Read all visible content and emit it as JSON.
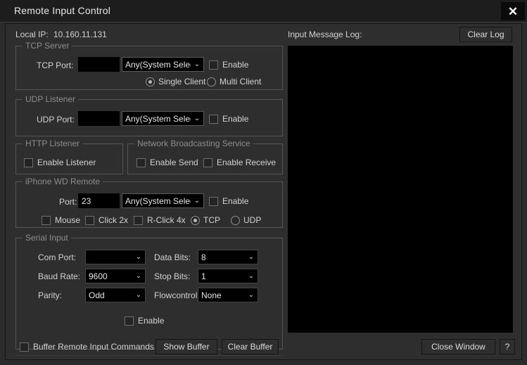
{
  "window": {
    "title": "Remote Input Control",
    "close_icon": "close-icon",
    "close_glyph": "✕"
  },
  "local_ip": {
    "label": "Local IP:",
    "value": "10.160.11.131"
  },
  "common": {
    "enable_label": "Enable",
    "chevron_glyph": "⌄",
    "any_system_selects": "Any(System Selects)"
  },
  "tcp_server": {
    "title": "TCP Server",
    "port_label": "TCP Port:",
    "port_value": "",
    "port_placeholder": "",
    "mode_combo_value": "Any(System Selects)",
    "enable_label": "Enable",
    "enable_checked": false,
    "radios": [
      {
        "label": "Single Client",
        "checked": true
      },
      {
        "label": "Multi Client",
        "checked": false
      }
    ]
  },
  "udp_listener": {
    "title": "UDP Listener",
    "port_label": "UDP Port:",
    "port_value": "",
    "mode_combo_value": "Any(System Selects)",
    "enable_label": "Enable",
    "enable_checked": false
  },
  "http_listener": {
    "title": "HTTP Listener",
    "enable_listener_label": "Enable Listener",
    "enable_listener_checked": false
  },
  "network_broadcasting": {
    "title": "Network Broadcasting Service",
    "enable_send_label": "Enable Send",
    "enable_send_checked": false,
    "enable_receive_label": "Enable Receive",
    "enable_receive_checked": false
  },
  "iphone_wd_remote": {
    "title": "iPhone WD Remote",
    "port_label": "Port:",
    "port_value": "23",
    "mode_combo_value": "Any(System Selects)",
    "enable_label": "Enable",
    "enable_checked": false,
    "mouse_label": "Mouse",
    "mouse_checked": false,
    "click2x_label": "Click 2x",
    "click2x_checked": false,
    "rclick4x_label": "R-Click 4x",
    "rclick4x_checked": false,
    "protocol_radios": [
      {
        "label": "TCP",
        "checked": true
      },
      {
        "label": "UDP",
        "checked": false
      }
    ]
  },
  "serial_input": {
    "title": "Serial Input",
    "com_port_label": "Com Port:",
    "com_port_value": "",
    "baud_rate_label": "Baud Rate:",
    "baud_rate_value": "9600",
    "parity_label": "Parity:",
    "parity_value": "Odd",
    "data_bits_label": "Data Bits:",
    "data_bits_value": "8",
    "stop_bits_label": "Stop Bits:",
    "stop_bits_value": "1",
    "flowcontrol_label": "Flowcontrol:",
    "flowcontrol_value": "None",
    "enable_label": "Enable",
    "enable_checked": false
  },
  "bottom_left": {
    "buffer_checkbox_label": "Buffer Remote Input Commands",
    "buffer_checked": false,
    "show_buffer_label": "Show Buffer",
    "clear_buffer_label": "Clear Buffer"
  },
  "log": {
    "label": "Input Message Log:",
    "clear_log_label": "Clear Log",
    "content": ""
  },
  "bottom_right": {
    "close_window_label": "Close Window",
    "help_label": "?"
  },
  "colors": {
    "window_bg": "#2b2b2b",
    "titlebar_bg": "#1d1d1d",
    "panel_bg": "#2e2e2e",
    "field_bg": "#000000",
    "text": "#d2d2d2",
    "text_dim": "#8d8d8d",
    "group_border": "#555555"
  }
}
